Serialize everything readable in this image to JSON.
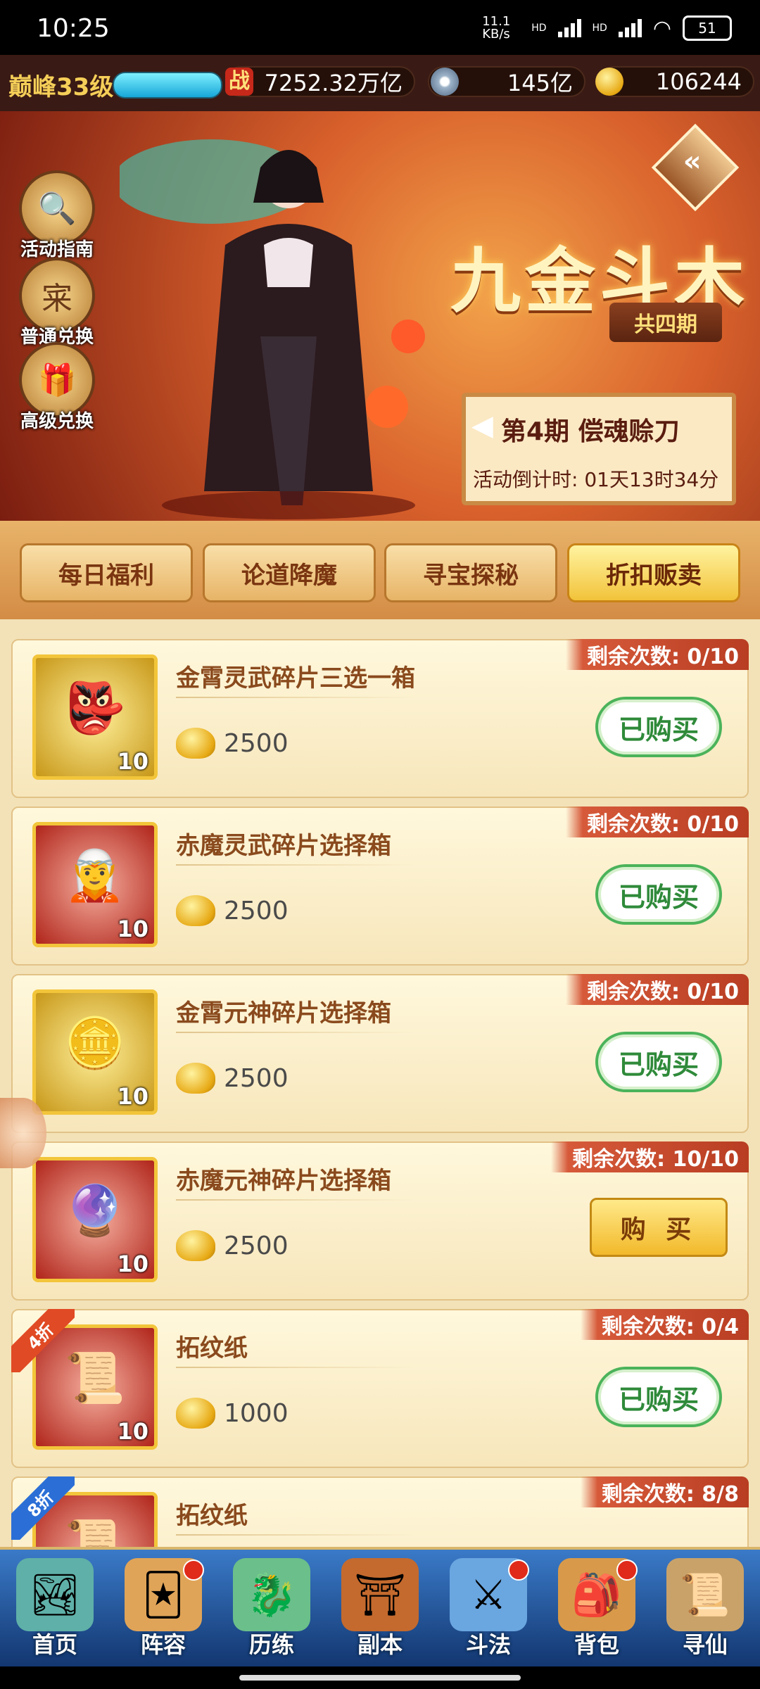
{
  "status_bar": {
    "time": "10:25",
    "net_speed": "11.1 KB/s",
    "hd1": "HD",
    "hd2": "HD",
    "battery": "51"
  },
  "resources": {
    "level": "巅峰33级",
    "power": "7252.32万亿",
    "copper": "145亿",
    "gold": "106244",
    "power_icon_char": "战"
  },
  "banner": {
    "title": "九金斗木",
    "periods": "共四期",
    "current_period": "第4期  偿魂赊刀",
    "countdown": "活动倒计时: 01天13时34分",
    "side_buttons": [
      {
        "label": "活动指南",
        "icon": "magnifier-icon",
        "glyph": "🔍"
      },
      {
        "label": "普通兑换",
        "icon": "exchange-icon",
        "glyph": "宷"
      },
      {
        "label": "高级兑换",
        "icon": "gift-icon",
        "glyph": "🎁"
      }
    ]
  },
  "tabs": [
    {
      "label": "每日福利",
      "active": false
    },
    {
      "label": "论道降魔",
      "active": false
    },
    {
      "label": "寻宝探秘",
      "active": false
    },
    {
      "label": "折扣贩卖",
      "active": true
    }
  ],
  "items": [
    {
      "name": "金霄灵武碎片三选一箱",
      "price": "2500",
      "remain": "剩余次数: 0/10",
      "qty": "10",
      "style": "gold",
      "glyph": "👺",
      "button": "已购买",
      "bought": true,
      "discount": ""
    },
    {
      "name": "赤魔灵武碎片选择箱",
      "price": "2500",
      "remain": "剩余次数: 0/10",
      "qty": "10",
      "style": "red",
      "glyph": "🧝",
      "button": "已购买",
      "bought": true,
      "discount": ""
    },
    {
      "name": "金霄元神碎片选择箱",
      "price": "2500",
      "remain": "剩余次数: 0/10",
      "qty": "10",
      "style": "gold",
      "glyph": "🪙",
      "button": "已购买",
      "bought": true,
      "discount": ""
    },
    {
      "name": "赤魔元神碎片选择箱",
      "price": "2500",
      "remain": "剩余次数: 10/10",
      "qty": "10",
      "style": "red",
      "glyph": "🔮",
      "button": "购 买",
      "bought": false,
      "discount": ""
    },
    {
      "name": "拓纹纸",
      "price": "1000",
      "remain": "剩余次数: 0/4",
      "qty": "10",
      "style": "red",
      "glyph": "📜",
      "button": "已购买",
      "bought": true,
      "discount": "4折",
      "discount_color": "red"
    },
    {
      "name": "拓纹纸",
      "price": "",
      "remain": "剩余次数: 8/8",
      "qty": "",
      "style": "red",
      "glyph": "📜",
      "button": "",
      "bought": false,
      "discount": "8折",
      "discount_color": "blue"
    }
  ],
  "nav": [
    {
      "label": "首页",
      "icon": "home-icon",
      "glyph": "🏞",
      "dot": false
    },
    {
      "label": "阵容",
      "icon": "lineup-icon",
      "glyph": "🃏",
      "dot": true
    },
    {
      "label": "历练",
      "icon": "training-icon",
      "glyph": "🐉",
      "dot": false
    },
    {
      "label": "副本",
      "icon": "dungeon-icon",
      "glyph": "⛩",
      "dot": false
    },
    {
      "label": "斗法",
      "icon": "battle-icon",
      "glyph": "⚔",
      "dot": true
    },
    {
      "label": "背包",
      "icon": "bag-icon",
      "glyph": "🎒",
      "dot": true
    },
    {
      "label": "寻仙",
      "icon": "scroll-icon",
      "glyph": "📜",
      "dot": false
    }
  ]
}
